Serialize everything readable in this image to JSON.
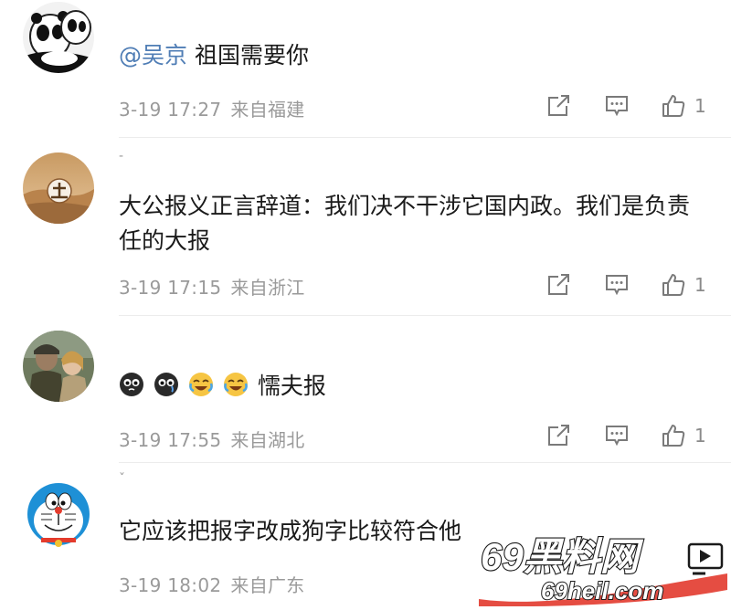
{
  "colors": {
    "mention": "#4f7db5",
    "meta": "#9a9a9a",
    "divider": "#ececec"
  },
  "comments": [
    {
      "username": "",
      "mention": "@吴京",
      "text": " 祖国需要你",
      "date": "3-19 17:27",
      "location": "来自福建",
      "likes": "1",
      "avatar_icon": "panda-avatar"
    },
    {
      "username": "-",
      "text": "大公报义正言辞道：我们决不干涉它国内政。我们是负责任的大报",
      "date": "3-19 17:15",
      "location": "来自浙江",
      "likes": "1",
      "avatar_icon": "desert-avatar"
    },
    {
      "username": "",
      "emojis": [
        "black-face-emoji",
        "black-face-emoji",
        "crying-laugh-emoji",
        "crying-laugh-emoji"
      ],
      "text": "懦夫报",
      "date": "3-19 17:55",
      "location": "来自湖北",
      "likes": "1",
      "avatar_icon": "soldier-avatar"
    },
    {
      "username": "ˇ",
      "text": "它应该把报字改成狗字比较符合他",
      "date": "3-19 18:02",
      "location": "来自广东",
      "avatar_icon": "doraemon-avatar"
    }
  ],
  "watermark": {
    "line1": "69黑料网",
    "line2": "69heil.com"
  }
}
